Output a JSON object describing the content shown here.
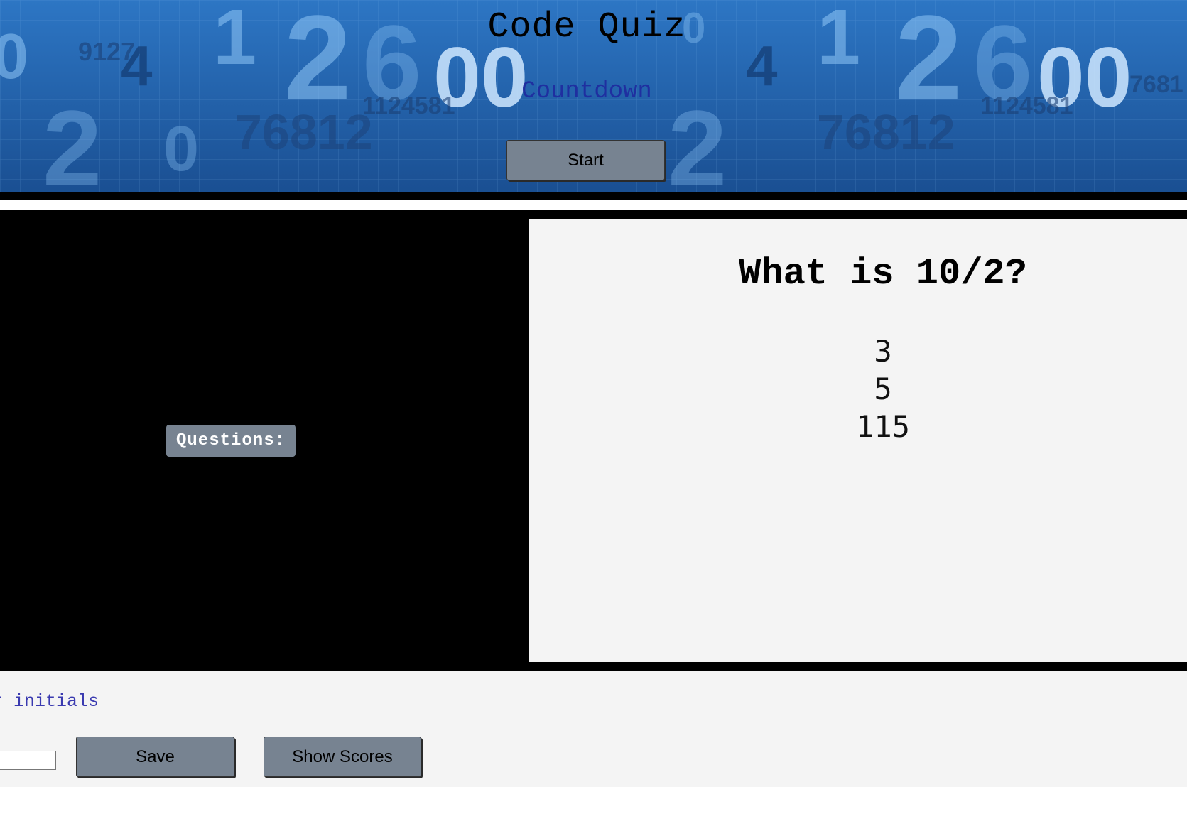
{
  "header": {
    "title": "Code Quiz",
    "countdown": "Countdown",
    "start_label": "Start"
  },
  "main": {
    "questions_label": "Questions:",
    "question": "What is 10/2?",
    "answers": [
      "3",
      "5",
      "115"
    ]
  },
  "footer": {
    "initials_label": "ur initials",
    "initials_value": "",
    "save_label": "Save",
    "show_scores_label": "Show Scores"
  },
  "colors": {
    "header_blue": "#1f5fa8",
    "button_gray": "#778391",
    "countdown_blue": "#1f2fa0",
    "card_bg": "#f4f4f4"
  }
}
